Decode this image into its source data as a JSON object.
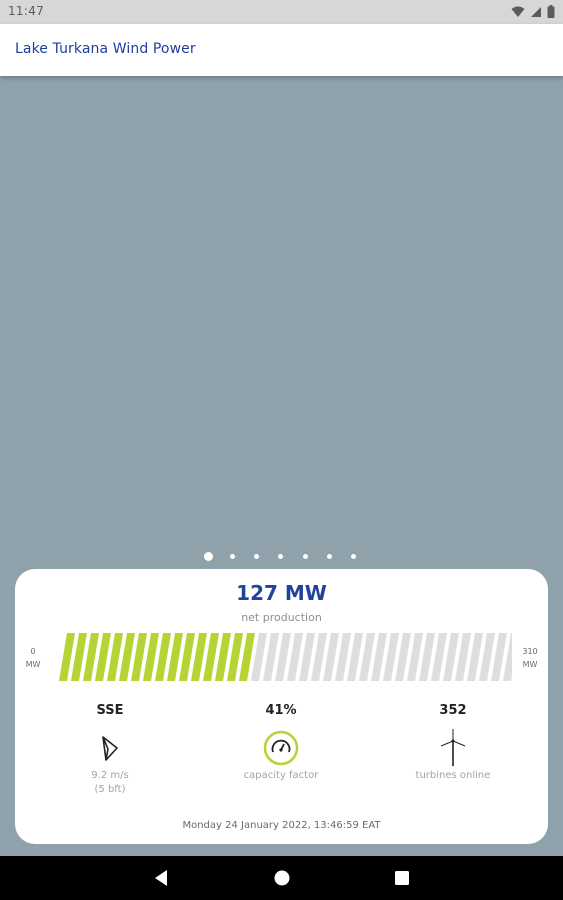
{
  "status_bar": {
    "time": "11:47",
    "icons": [
      "wifi-icon",
      "signal-icon",
      "battery-icon"
    ]
  },
  "app_bar": {
    "title": "Lake Turkana Wind Power"
  },
  "pager": {
    "total_pages": 7,
    "active_page": 1
  },
  "production": {
    "value": "127 MW",
    "caption": "net production",
    "scale_min": "0",
    "scale_min_unit": "MW",
    "scale_max": "310",
    "scale_max_unit": "MW",
    "fill_fraction": 0.41
  },
  "stats": {
    "wind": {
      "value": "SSE",
      "icon": "wind-direction-arrow-icon",
      "caption_line1": "9.2 m/s",
      "caption_line2": "(5 bft)"
    },
    "capacity": {
      "value": "41%",
      "icon": "gauge-icon",
      "caption": "capacity factor"
    },
    "turbines": {
      "value": "352",
      "icon": "wind-turbine-icon",
      "caption": "turbines online"
    }
  },
  "timestamp": "Monday 24 January 2022, 13:46:59 EAT",
  "colors": {
    "accent_blue": "#23429b",
    "bar_active": "#b6d334",
    "bar_inactive": "#dedede",
    "background": "#8fa2ab"
  },
  "nav_bar": {
    "buttons": [
      "back-icon",
      "home-icon",
      "recents-icon"
    ]
  }
}
